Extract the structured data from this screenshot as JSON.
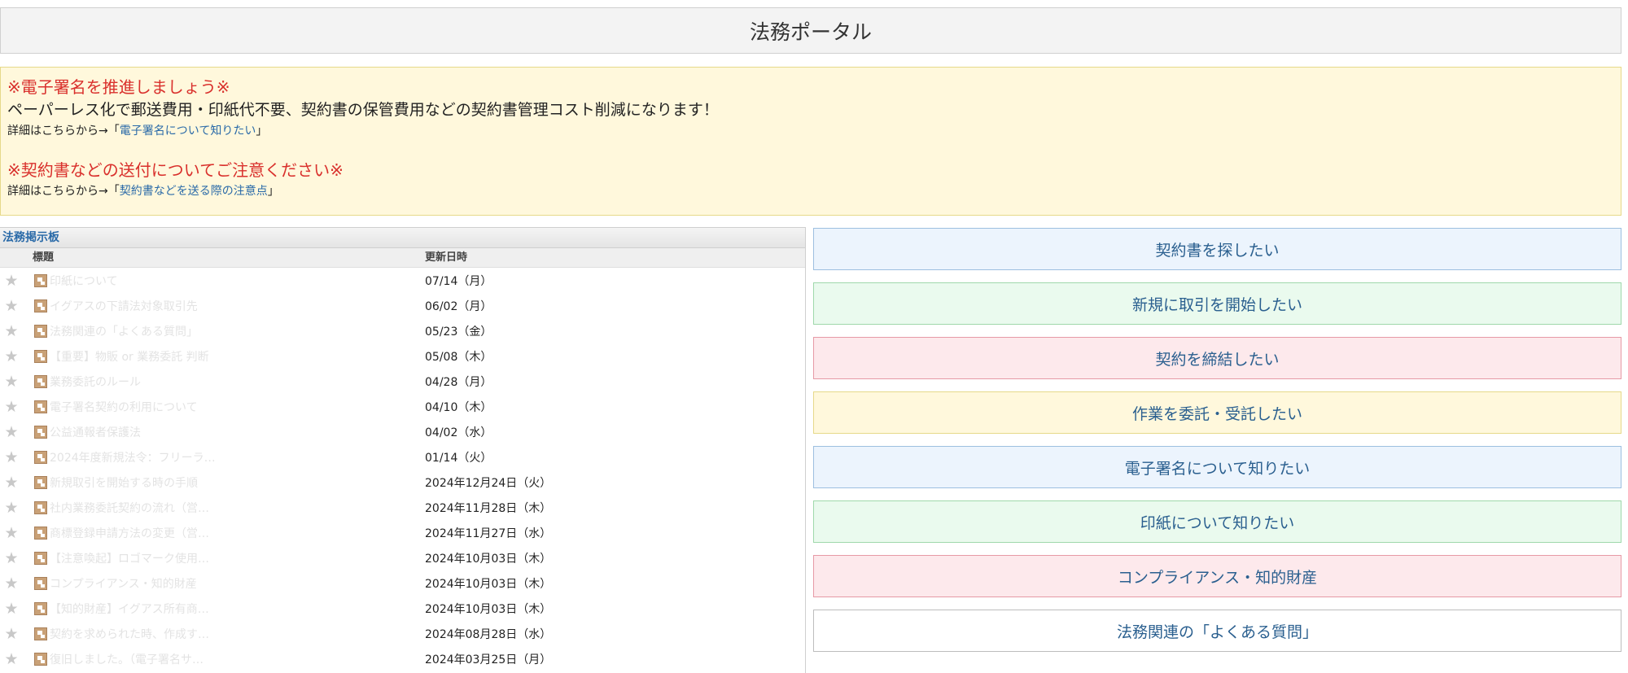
{
  "page": {
    "title": "法務ポータル"
  },
  "notice": {
    "heading1": "※電子署名を推進しましょう※",
    "text1": "ペーパーレス化で郵送費用・印紙代不要、契約書の保管費用などの契約書管理コスト削減になります！",
    "detail_prefix": "詳細はこちらから→「",
    "detail_suffix": "」",
    "link1": "電子署名について知りたい",
    "heading2": "※契約書などの送付についてご注意ください※",
    "link2": "契約書などを送る際の注意点"
  },
  "board": {
    "title": "法務掲示板",
    "col_title": "標題",
    "col_date": "更新日時",
    "rows": [
      {
        "title": "印紙について",
        "date": "07/14（月）"
      },
      {
        "title": "イグアスの下請法対象取引先",
        "date": "06/02（月）"
      },
      {
        "title": "法務関連の「よくある質問」",
        "date": "05/23（金）"
      },
      {
        "title": "【重要】物販 or 業務委託 判断",
        "date": "05/08（木）"
      },
      {
        "title": "業務委託のルール",
        "date": "04/28（月）"
      },
      {
        "title": "電子署名契約の利用について",
        "date": "04/10（木）"
      },
      {
        "title": "公益通報者保護法",
        "date": "04/02（水）"
      },
      {
        "title": "2024年度新規法令：フリーラ…",
        "date": "01/14（火）"
      },
      {
        "title": "新規取引を開始する時の手順",
        "date": "2024年12月24日（火）"
      },
      {
        "title": "社内業務委託契約の流れ（営…",
        "date": "2024年11月28日（木）"
      },
      {
        "title": "商標登録申請方法の変更（営…",
        "date": "2024年11月27日（水）"
      },
      {
        "title": "【注意喚起】ロゴマーク使用…",
        "date": "2024年10月03日（木）"
      },
      {
        "title": "コンプライアンス・知的財産",
        "date": "2024年10月03日（木）"
      },
      {
        "title": "【知的財産】イグアス所有商…",
        "date": "2024年10月03日（木）"
      },
      {
        "title": "契約を求められた時、作成す…",
        "date": "2024年08月28日（水）"
      },
      {
        "title": "復旧しました。（電子署名サ…",
        "date": "2024年03月25日（月）"
      }
    ]
  },
  "buttons": [
    {
      "label": "契約書を探したい",
      "color": "blue"
    },
    {
      "label": "新規に取引を開始したい",
      "color": "green"
    },
    {
      "label": "契約を締結したい",
      "color": "red"
    },
    {
      "label": "作業を委託・受託したい",
      "color": "yellow"
    },
    {
      "label": "電子署名について知りたい",
      "color": "blue"
    },
    {
      "label": "印紙について知りたい",
      "color": "green"
    },
    {
      "label": "コンプライアンス・知的財産",
      "color": "red"
    },
    {
      "label": "法務関連の「よくある質問」",
      "color": "white"
    }
  ],
  "icons": {
    "favorite": "star-icon",
    "document": "document-icon"
  }
}
